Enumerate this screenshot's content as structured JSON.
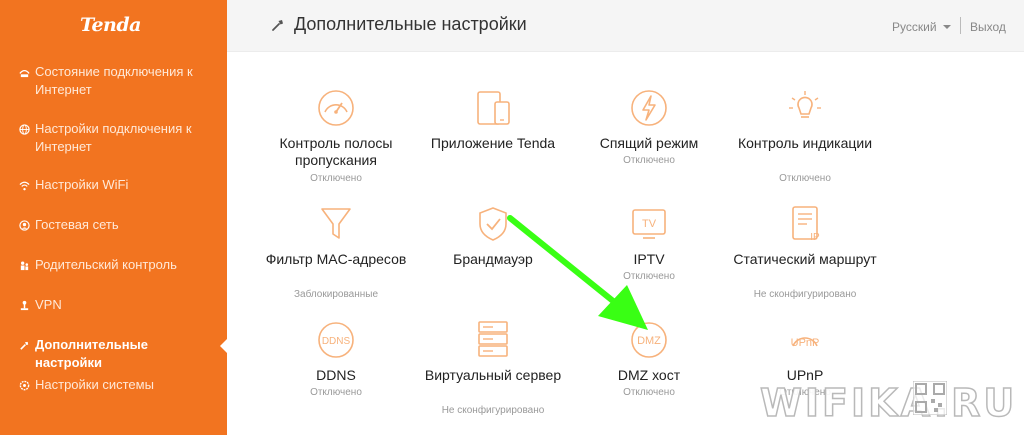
{
  "brand": {
    "logo": "Tenda",
    "accent": "#f27420"
  },
  "sidebar": {
    "items": [
      {
        "label": "Состояние подключения к Интернет",
        "icon": "globe-status-icon",
        "active": false
      },
      {
        "label": "Настройки подключения к Интернет",
        "icon": "globe-icon",
        "active": false
      },
      {
        "label": "Настройки WiFi",
        "icon": "wifi-icon",
        "active": false
      },
      {
        "label": "Гостевая сеть",
        "icon": "guest-icon",
        "active": false
      },
      {
        "label": "Родительский контроль",
        "icon": "parental-icon",
        "active": false
      },
      {
        "label": "VPN",
        "icon": "vpn-icon",
        "active": false
      },
      {
        "label": "Дополнительные настройки",
        "icon": "wrench-icon",
        "active": true
      },
      {
        "label": "Настройки системы",
        "icon": "gear-icon",
        "active": false
      }
    ]
  },
  "header": {
    "title": "Дополнительные настройки",
    "language": "Русский",
    "logout": "Выход"
  },
  "tiles": [
    {
      "name": "Контроль полосы пропускания",
      "status": "Отключено",
      "icon": "gauge-icon"
    },
    {
      "name": "Приложение Tenda",
      "status": "",
      "icon": "devices-icon"
    },
    {
      "name": "Спящий режим",
      "status": "Отключено",
      "icon": "lightning-icon"
    },
    {
      "name": "Контроль индикации",
      "status": "Отключено",
      "icon": "lightbulb-icon"
    },
    {
      "name": "Фильтр MAC-адресов",
      "status": "Заблокированные",
      "icon": "filter-icon"
    },
    {
      "name": "Брандмауэр",
      "status": "",
      "icon": "shield-icon"
    },
    {
      "name": "IPTV",
      "status": "Отключено",
      "icon": "tv-icon",
      "icon_text": "TV"
    },
    {
      "name": "Статический маршрут",
      "status": "Не сконфигурировано",
      "icon": "route-icon",
      "icon_text": "IP"
    },
    {
      "name": "DDNS",
      "status": "Отключено",
      "icon": "ddns-icon",
      "icon_text": "DDNS"
    },
    {
      "name": "Виртуальный сервер",
      "status": "Не сконфигурировано",
      "icon": "server-icon"
    },
    {
      "name": "DMZ хост",
      "status": "Отключено",
      "icon": "dmz-icon",
      "icon_text": "DMZ"
    },
    {
      "name": "UPnP",
      "status": "Отключено",
      "icon": "upnp-icon",
      "icon_text": "UPnP"
    }
  ],
  "watermark": {
    "text": "WIFIKA.RU"
  },
  "colors": {
    "icon_stroke": "#f7b27c",
    "arrow": "#39ff14"
  }
}
